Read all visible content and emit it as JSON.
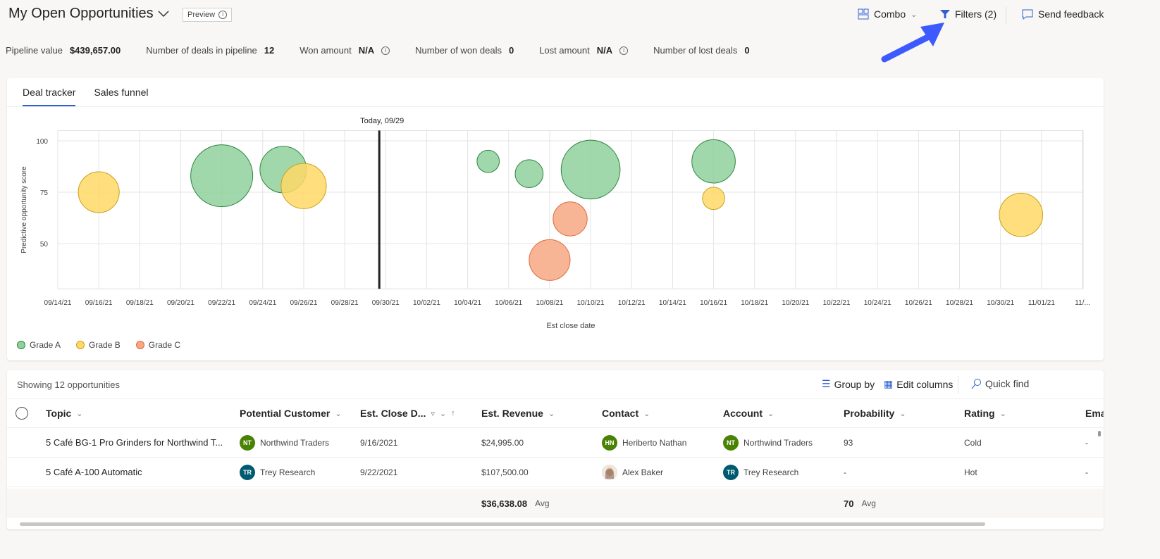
{
  "header": {
    "title": "My Open Opportunities",
    "preview": "Preview",
    "combo": "Combo",
    "filters": "Filters (2)",
    "feedback": "Send feedback"
  },
  "kpis": [
    {
      "label": "Pipeline value",
      "value": "$439,657.00",
      "info": false
    },
    {
      "label": "Number of deals in pipeline",
      "value": "12",
      "info": false
    },
    {
      "label": "Won amount",
      "value": "N/A",
      "info": true
    },
    {
      "label": "Number of won deals",
      "value": "0",
      "info": false
    },
    {
      "label": "Lost amount",
      "value": "N/A",
      "info": true
    },
    {
      "label": "Number of lost deals",
      "value": "0",
      "info": false
    }
  ],
  "tabs": [
    {
      "label": "Deal tracker",
      "active": true
    },
    {
      "label": "Sales funnel",
      "active": false
    }
  ],
  "colors": {
    "accent": "#2f5fd0",
    "annotation_arrow": "#3d5afe",
    "grade_a_fill": "#8fd19e",
    "grade_a_stroke": "#2e8540",
    "grade_b_fill": "#ffd966",
    "grade_b_stroke": "#c9a11a",
    "grade_c_fill": "#f7a882",
    "grade_c_stroke": "#dd6b3a"
  },
  "chart_data": {
    "type": "scatter",
    "subtype": "bubble",
    "today_label": "Today, 09/29",
    "today": "2021-09-29",
    "xlabel": "Est close date",
    "ylabel": "Predictive opportunity score",
    "xlim": [
      "2021-09-14",
      "2021-11-03"
    ],
    "ylim": [
      28,
      105
    ],
    "yticks": [
      50,
      75,
      100
    ],
    "xticks": [
      "09/14/21",
      "09/16/21",
      "09/18/21",
      "09/20/21",
      "09/22/21",
      "09/24/21",
      "09/26/21",
      "09/28/21",
      "09/30/21",
      "10/02/21",
      "10/04/21",
      "10/06/21",
      "10/08/21",
      "10/10/21",
      "10/12/21",
      "10/14/21",
      "10/16/21",
      "10/18/21",
      "10/20/21",
      "10/22/21",
      "10/24/21",
      "10/26/21",
      "10/28/21",
      "10/30/21",
      "11/01/21",
      "11/..."
    ],
    "grid": true,
    "legend": {
      "placement": "bottom-left",
      "entries": [
        "Grade A",
        "Grade B",
        "Grade C"
      ]
    },
    "points": [
      {
        "date": "2021-09-16",
        "score": 75,
        "size": 66,
        "grade": "B"
      },
      {
        "date": "2021-09-22",
        "score": 83,
        "size": 100,
        "grade": "A"
      },
      {
        "date": "2021-09-25",
        "score": 86,
        "size": 75,
        "grade": "A"
      },
      {
        "date": "2021-09-26",
        "score": 78,
        "size": 73,
        "grade": "B"
      },
      {
        "date": "2021-10-05",
        "score": 90,
        "size": 36,
        "grade": "A"
      },
      {
        "date": "2021-10-07",
        "score": 84,
        "size": 45,
        "grade": "A"
      },
      {
        "date": "2021-10-09",
        "score": 62,
        "size": 55,
        "grade": "C"
      },
      {
        "date": "2021-10-08",
        "score": 42,
        "size": 66,
        "grade": "C"
      },
      {
        "date": "2021-10-10",
        "score": 86,
        "size": 95,
        "grade": "A"
      },
      {
        "date": "2021-10-16",
        "score": 90,
        "size": 70,
        "grade": "A"
      },
      {
        "date": "2021-10-16",
        "score": 72,
        "size": 36,
        "grade": "B"
      },
      {
        "date": "2021-10-31",
        "score": 64,
        "size": 70,
        "grade": "B"
      }
    ]
  },
  "table": {
    "showing": "Showing 12 opportunities",
    "group_by": "Group by",
    "edit_columns": "Edit columns",
    "quick_find": "Quick find",
    "columns": [
      "Topic",
      "Potential Customer",
      "Est. Close D...",
      "Est. Revenue",
      "Contact",
      "Account",
      "Probability",
      "Rating",
      "Emai"
    ],
    "rows": [
      {
        "topic": "5 Café BG-1 Pro Grinders for Northwind T...",
        "customer": "Northwind Traders",
        "customer_initials": "NT",
        "customer_color": "#498205",
        "close": "9/16/2021",
        "revenue": "$24,995.00",
        "contact": "Heriberto Nathan",
        "contact_initials": "HN",
        "contact_color": "#498205",
        "account": "Northwind Traders",
        "account_initials": "NT",
        "account_color": "#498205",
        "probability": "93",
        "rating": "Cold",
        "email": "-"
      },
      {
        "topic": "5 Café A-100 Automatic",
        "customer": "Trey Research",
        "customer_initials": "TR",
        "customer_color": "#005b70",
        "close": "9/22/2021",
        "revenue": "$107,500.00",
        "contact": "Alex Baker",
        "contact_initials": "",
        "contact_color": "#c9a98a",
        "account": "Trey Research",
        "account_initials": "TR",
        "account_color": "#005b70",
        "probability": "-",
        "rating": "Hot",
        "email": "-"
      }
    ],
    "footer": {
      "revenue": "$36,638.08",
      "revenue_agg": "Avg",
      "probability": "70",
      "probability_agg": "Avg"
    }
  }
}
